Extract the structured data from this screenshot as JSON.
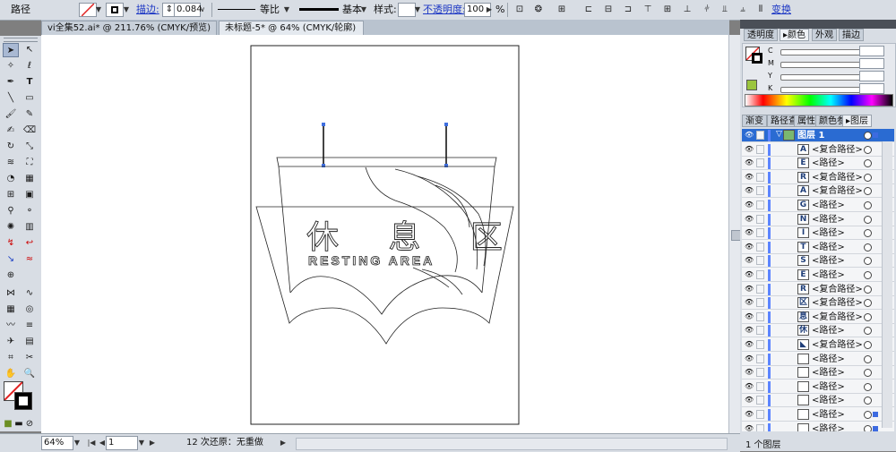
{
  "control_bar": {
    "object_type": "路径",
    "stroke_label": "描边:",
    "stroke_weight": "0.084",
    "profile_label": "等比",
    "brush_label": "基本",
    "style_label": "样式:",
    "opacity_label": "不透明度:",
    "opacity_value": "100",
    "opacity_unit": "%",
    "transform_label": "变换"
  },
  "tabs": [
    {
      "label": "vi全集52.ai* @ 211.76% (CMYK/预览)",
      "close": "×"
    },
    {
      "label": "未标题-5* @ 64% (CMYK/轮廓)",
      "close": "×"
    }
  ],
  "artwork": {
    "chinese_title": "休 息 区",
    "english_title": "RESTING AREA"
  },
  "status_bar": {
    "zoom": "64%",
    "page": "1",
    "undo_info": "12 次还原：无重做"
  },
  "panels": {
    "top_tabs": [
      "透明度",
      "颜色",
      "外观",
      "描边"
    ],
    "color_channels": [
      "C",
      "M",
      "Y",
      "K"
    ],
    "color_pct": "%",
    "mid_tabs": [
      "渐变",
      "路径查",
      "属性",
      "颜色参",
      "图层"
    ],
    "layers_footer": "1 个图层"
  },
  "layers": [
    {
      "name": "图层 1",
      "thumb": "",
      "head": true
    },
    {
      "name": "<复合路径>",
      "thumb": "A"
    },
    {
      "name": "<路径>",
      "thumb": "E"
    },
    {
      "name": "<复合路径>",
      "thumb": "R"
    },
    {
      "name": "<复合路径>",
      "thumb": "A"
    },
    {
      "name": "<路径>",
      "thumb": "G"
    },
    {
      "name": "<路径>",
      "thumb": "N"
    },
    {
      "name": "<路径>",
      "thumb": "I"
    },
    {
      "name": "<路径>",
      "thumb": "T"
    },
    {
      "name": "<路径>",
      "thumb": "S"
    },
    {
      "name": "<路径>",
      "thumb": "E"
    },
    {
      "name": "<复合路径>",
      "thumb": "R"
    },
    {
      "name": "<复合路径>",
      "thumb": "区"
    },
    {
      "name": "<复合路径>",
      "thumb": "息"
    },
    {
      "name": "<路径>",
      "thumb": "休"
    },
    {
      "name": "<复合路径>",
      "thumb": "◣"
    },
    {
      "name": "<路径>",
      "thumb": ""
    },
    {
      "name": "<路径>",
      "thumb": ""
    },
    {
      "name": "<路径>",
      "thumb": ""
    },
    {
      "name": "<路径>",
      "thumb": ""
    },
    {
      "name": "<路径>",
      "thumb": ""
    },
    {
      "name": "<路径>",
      "thumb": ""
    },
    {
      "name": "<路径>",
      "thumb": ""
    }
  ],
  "colors": {
    "selection": "#3f6fe0",
    "layer_bar": "#5b84ff",
    "header": "#2a6bd2"
  }
}
